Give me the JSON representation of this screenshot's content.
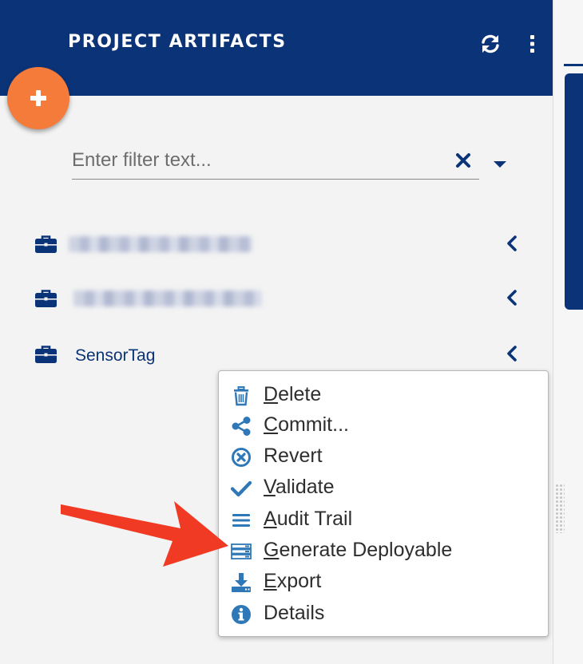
{
  "header": {
    "title": "PROJECT ARTIFACTS",
    "refresh_icon": "refresh-icon",
    "menu_icon": "kebab-menu-icon",
    "background": "#0b3378"
  },
  "fab": {
    "icon": "plus-icon",
    "color": "#f47b3a"
  },
  "filter": {
    "placeholder": "Enter filter text...",
    "value": ""
  },
  "projects": [
    {
      "label": "",
      "redacted": true,
      "icon": "briefcase-icon"
    },
    {
      "label": "",
      "redacted": true,
      "icon": "briefcase-icon"
    },
    {
      "label": "SensorTag",
      "redacted": false,
      "icon": "briefcase-icon"
    }
  ],
  "context_menu": {
    "items": [
      {
        "label": "Delete",
        "icon": "trash-icon",
        "mnemonic": "D"
      },
      {
        "label": "Commit...",
        "icon": "share-icon",
        "mnemonic": "C"
      },
      {
        "label": "Revert",
        "icon": "revert-circle-x-icon"
      },
      {
        "label": "Validate",
        "icon": "check-icon",
        "mnemonic": "V"
      },
      {
        "label": "Audit Trail",
        "icon": "list-icon",
        "mnemonic": "A"
      },
      {
        "label": "Generate Deployable",
        "icon": "server-stack-icon",
        "mnemonic": "G"
      },
      {
        "label": "Export",
        "icon": "download-icon",
        "mnemonic": "E"
      },
      {
        "label": "Details",
        "icon": "info-icon"
      }
    ]
  },
  "colors": {
    "icon_blue": "#2f78b8",
    "arrow": "#f03a24",
    "text_navy": "#0b3378"
  }
}
